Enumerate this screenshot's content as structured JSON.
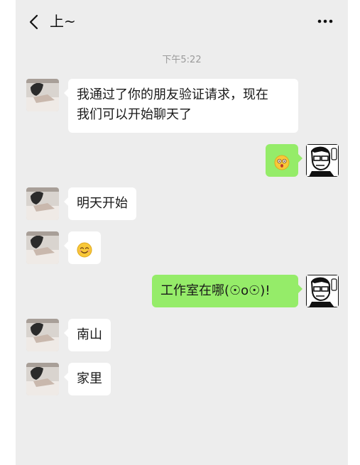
{
  "header": {
    "back_icon": "chevron-left-icon",
    "title": "上~",
    "more_icon": "more-dots-icon"
  },
  "timestamp": "下午5:22",
  "messages": [
    {
      "side": "left",
      "text": "我通过了你的朋友验证请求，现在我们可以开始聊天了",
      "line1": "我通过了你的朋友验证请求，现在",
      "line2": "我们可以开始聊天了"
    },
    {
      "side": "right",
      "emoji": "surprised-face-emoji"
    },
    {
      "side": "left",
      "text": "明天开始"
    },
    {
      "side": "left",
      "emoji": "smiling-face-emoji"
    },
    {
      "side": "right",
      "text": "工作室在哪(☉o☉)!"
    },
    {
      "side": "left",
      "text": "南山"
    },
    {
      "side": "left",
      "text": "家里"
    }
  ],
  "colors": {
    "background": "#ededed",
    "my_bubble": "#95ec69",
    "their_bubble": "#ffffff",
    "timestamp": "#9a9a9a"
  }
}
